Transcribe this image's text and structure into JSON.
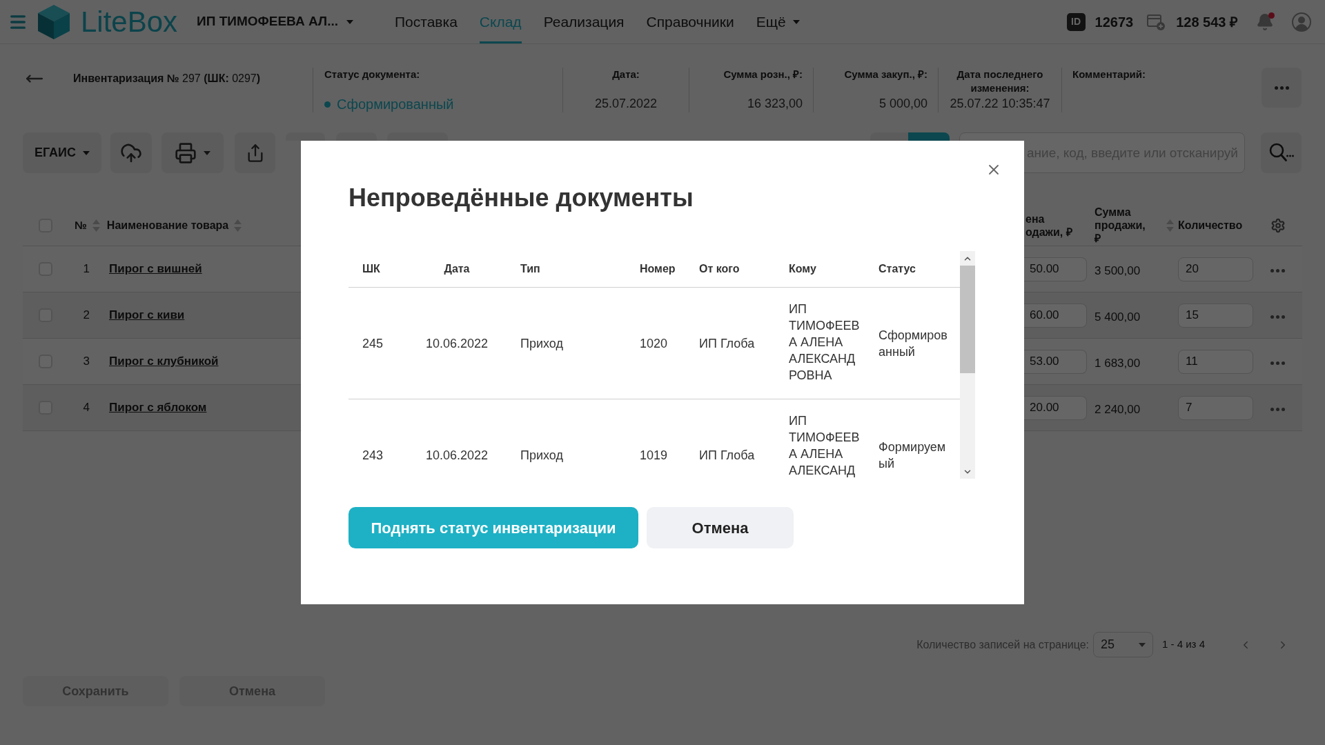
{
  "top_bar": {
    "logo_text": "LiteBox",
    "organization": "ИП ТИМОФЕЕВА АЛ...",
    "nav": [
      {
        "label": "Поставка",
        "kind": "link",
        "selected": false
      },
      {
        "label": "Склад",
        "kind": "link",
        "selected": true
      },
      {
        "label": "Реализация",
        "kind": "link",
        "selected": false
      },
      {
        "label": "Справочники",
        "kind": "link",
        "selected": false
      },
      {
        "label": "Ещё",
        "kind": "menu",
        "selected": false
      }
    ],
    "id_badge": "ID",
    "id_value": "12673",
    "balance": "128 543 ₽",
    "has_notifications": true
  },
  "document": {
    "title": "**Инвентаризация №** 297 **(ШК:** 0297**)**",
    "fields": [
      {
        "kind": "status",
        "label": "Статус документа:",
        "value": "Сформированный"
      },
      {
        "kind": "center",
        "label": "Дата:",
        "value": "25.07.2022"
      },
      {
        "kind": "amount",
        "label": "Сумма розн., ₽:",
        "value": "16 323,00"
      },
      {
        "kind": "amount",
        "label": "Сумма закуп., ₽:",
        "value": "5 000,00"
      },
      {
        "kind": "center",
        "label": "Дата последнего изменения:",
        "value": "25.07.22 10:35:47"
      },
      {
        "kind": "text",
        "label": "Комментарий:"
      }
    ]
  },
  "toolbar": {
    "egais_label": "ЕГАИС",
    "view_modes": [
      {
        "selected": false
      },
      {
        "selected": true
      }
    ],
    "search_placeholder": "ание, код, введите или отсканируй"
  },
  "table": {
    "all_checked": false,
    "columns": [
      "№",
      "Наименование товара",
      "ена одажи, ₽",
      "Сумма продажи, ₽",
      "Количество"
    ],
    "rows": [
      {
        "checked": false,
        "number": "1",
        "name": "Пирог с вишней",
        "price": "50.00",
        "sum": "3 500,00",
        "quantity": "20"
      },
      {
        "checked": false,
        "number": "2",
        "name": "Пирог с киви",
        "price": "60.00",
        "sum": "5 400,00",
        "quantity": "15"
      },
      {
        "checked": false,
        "number": "3",
        "name": "Пирог с клубникой",
        "price": "53.00",
        "sum": "1 683,00",
        "quantity": "11"
      },
      {
        "checked": false,
        "number": "4",
        "name": "Пирог с яблоком",
        "price": "20.00",
        "sum": "2 240,00",
        "quantity": "7"
      }
    ]
  },
  "pagination": {
    "label": "Количество записей на странице:",
    "page_size": "25",
    "range": "1 - 4 из 4"
  },
  "footer_buttons": [
    {
      "label": "Сохранить",
      "disabled": true
    },
    {
      "label": "Отмена",
      "disabled": true
    }
  ],
  "modal": {
    "title": "Непроведённые документы",
    "columns": [
      "ШК",
      "Дата",
      "Тип",
      "Номер",
      "От кого",
      "Кому",
      "Статус"
    ],
    "rows": [
      {
        "barcode": "245",
        "date": "10.06.2022",
        "type": "Приход",
        "number": "1020",
        "from": "ИП Глоба",
        "to": "ИП ТИМОФЕЕВА АЛЕНА АЛЕКСАНДРОВНА",
        "status": "Сформированный"
      },
      {
        "barcode": "243",
        "date": "10.06.2022",
        "type": "Приход",
        "number": "1019",
        "from": "ИП Глоба",
        "to": "ИП ТИМОФЕЕВА АЛЕНА АЛЕКСАНД",
        "status": "Формируемый"
      }
    ],
    "buttons": [
      {
        "label": "Поднять статус инвентаризации",
        "kind": "primary"
      },
      {
        "label": "Отмена",
        "kind": "secondary"
      }
    ]
  }
}
